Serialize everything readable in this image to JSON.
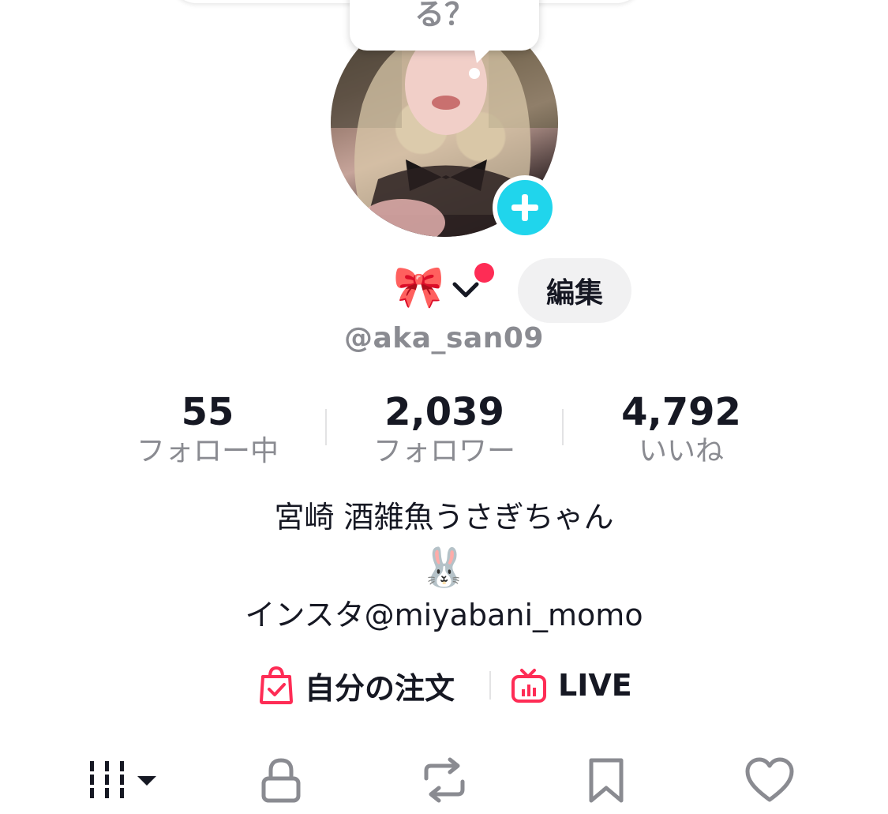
{
  "speech_bubble": {
    "text": "る？"
  },
  "profile": {
    "display_emoji": "🎀",
    "edit_label": "編集",
    "username": "@aka_san09"
  },
  "stats": [
    {
      "value": "55",
      "label": "フォロー中"
    },
    {
      "value": "2,039",
      "label": "フォロワー"
    },
    {
      "value": "4,792",
      "label": "いいね"
    }
  ],
  "bio": {
    "line1": "宮崎 酒雑魚うさぎちゃん",
    "emoji": "🐰",
    "line3": "インスタ@miyabani_momo"
  },
  "links": [
    {
      "label": "自分の注文",
      "icon": "shopping-bag-check-icon"
    },
    {
      "label": "LIVE",
      "icon": "tv-live-icon"
    }
  ],
  "tabs": [
    {
      "icon": "grid-videos-icon",
      "selected": true
    },
    {
      "icon": "lock-icon",
      "selected": false
    },
    {
      "icon": "repost-icon",
      "selected": false
    },
    {
      "icon": "bookmark-icon",
      "selected": false
    },
    {
      "icon": "heart-icon",
      "selected": false
    }
  ],
  "colors": {
    "accent_cyan": "#20d5ec",
    "notification_red": "#fe2c55",
    "link_icon_red": "#fe2c55",
    "secondary_text": "#8a8b91",
    "primary_text": "#161823",
    "button_bg": "#f1f1f2"
  }
}
